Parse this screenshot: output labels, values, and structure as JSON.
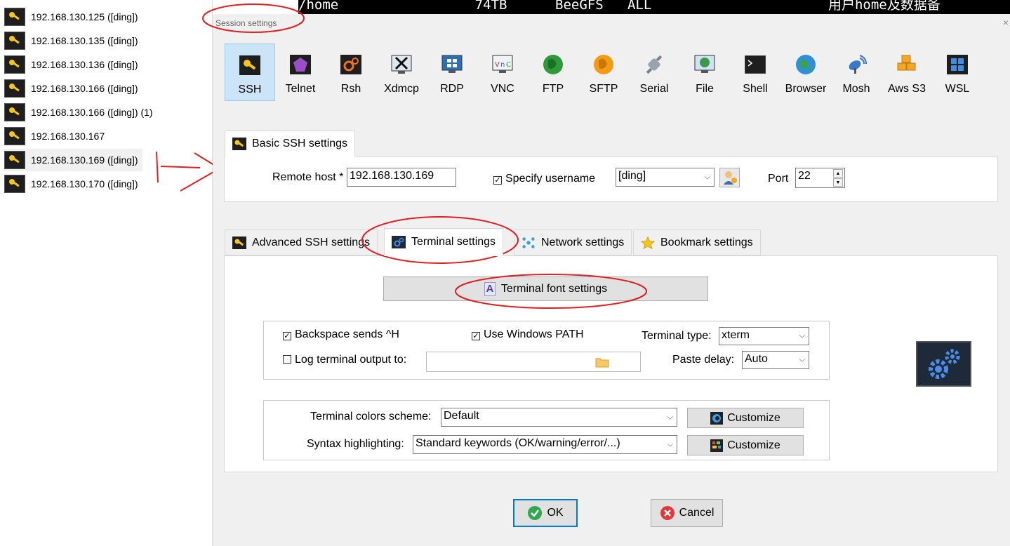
{
  "terminal_strip": {
    "text": "/home                 74TB      BeeGFS   ALL                      用户home及数据备"
  },
  "sessions": [
    {
      "label": "192.168.130.125 ([ding])"
    },
    {
      "label": "192.168.130.135 ([ding])"
    },
    {
      "label": "192.168.130.136 ([ding])"
    },
    {
      "label": "192.168.130.166 ([ding])"
    },
    {
      "label": "192.168.130.166 ([ding]) (1)"
    },
    {
      "label": "192.168.130.167"
    },
    {
      "label": "192.168.130.169 ([ding])",
      "selected": true
    },
    {
      "label": "192.168.130.170 ([ding])"
    }
  ],
  "dialog": {
    "title": "Session settings",
    "close": "×",
    "session_types": [
      {
        "label": "SSH",
        "icon": "key-icon",
        "selected": true
      },
      {
        "label": "Telnet",
        "icon": "telnet-icon"
      },
      {
        "label": "Rsh",
        "icon": "rsh-icon"
      },
      {
        "label": "Xdmcp",
        "icon": "xdmcp-icon"
      },
      {
        "label": "RDP",
        "icon": "rdp-icon"
      },
      {
        "label": "VNC",
        "icon": "vnc-icon"
      },
      {
        "label": "FTP",
        "icon": "ftp-icon"
      },
      {
        "label": "SFTP",
        "icon": "sftp-icon"
      },
      {
        "label": "Serial",
        "icon": "serial-icon"
      },
      {
        "label": "File",
        "icon": "file-icon"
      },
      {
        "label": "Shell",
        "icon": "shell-icon"
      },
      {
        "label": "Browser",
        "icon": "browser-icon"
      },
      {
        "label": "Mosh",
        "icon": "mosh-icon"
      },
      {
        "label": "Aws S3",
        "icon": "aws-s3-icon"
      },
      {
        "label": "WSL",
        "icon": "wsl-icon"
      }
    ],
    "basic": {
      "tab_label": "Basic SSH settings",
      "remote_host_label": "Remote host *",
      "remote_host_value": "192.168.130.169",
      "specify_username_label": "Specify username",
      "specify_username_checked": true,
      "username_value": "[ding]",
      "port_label": "Port",
      "port_value": "22"
    },
    "tabs": [
      {
        "label": "Advanced SSH settings",
        "icon": "key-icon"
      },
      {
        "label": "Terminal settings",
        "icon": "terminal-gear-icon",
        "active": true
      },
      {
        "label": "Network settings",
        "icon": "network-icon"
      },
      {
        "label": "Bookmark settings",
        "icon": "star-icon"
      }
    ],
    "terminal": {
      "font_button": "Terminal font settings",
      "backspace_label": "Backspace sends ^H",
      "backspace_checked": true,
      "windows_path_label": "Use Windows PATH",
      "windows_path_checked": true,
      "terminal_type_label": "Terminal type:",
      "terminal_type_value": "xterm",
      "log_output_label": "Log terminal output to:",
      "log_output_checked": false,
      "log_output_value": "",
      "paste_delay_label": "Paste delay:",
      "paste_delay_value": "Auto",
      "colors_label": "Terminal colors scheme:",
      "colors_value": "Default",
      "syntax_label": "Syntax highlighting:",
      "syntax_value": "Standard keywords (OK/warning/error/...)",
      "customize_label": "Customize"
    },
    "ok_label": "OK",
    "cancel_label": "Cancel"
  },
  "colors": {
    "selected_type_bg": "#cce4f7",
    "annotation_red": "#e02020",
    "ok_green": "#2fa84f",
    "cancel_red": "#e03a3a"
  }
}
